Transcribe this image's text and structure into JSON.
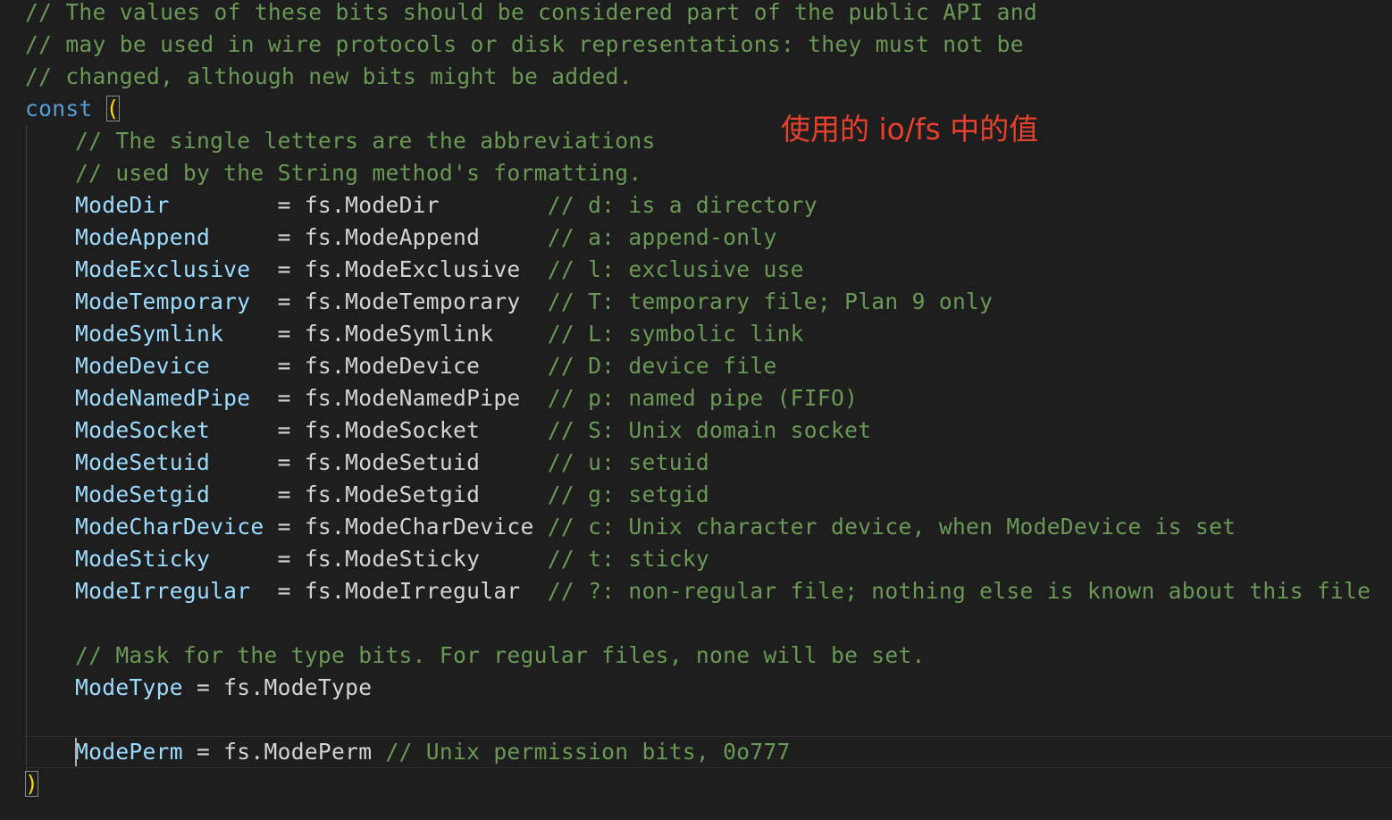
{
  "header_comments": [
    "// The values of these bits should be considered part of the public API and",
    "// may be used in wire protocols or disk representations: they must not be",
    "// changed, although new bits might be added."
  ],
  "const_keyword": "const",
  "open_paren": "(",
  "close_paren": ")",
  "block_comments": [
    "// The single letters are the abbreviations",
    "// used by the String method's formatting."
  ],
  "assignments": [
    {
      "name": "ModeDir        ",
      "value": "= fs.ModeDir        ",
      "comment": "// d: is a directory"
    },
    {
      "name": "ModeAppend     ",
      "value": "= fs.ModeAppend     ",
      "comment": "// a: append-only"
    },
    {
      "name": "ModeExclusive  ",
      "value": "= fs.ModeExclusive  ",
      "comment": "// l: exclusive use"
    },
    {
      "name": "ModeTemporary  ",
      "value": "= fs.ModeTemporary  ",
      "comment": "// T: temporary file; Plan 9 only"
    },
    {
      "name": "ModeSymlink    ",
      "value": "= fs.ModeSymlink    ",
      "comment": "// L: symbolic link"
    },
    {
      "name": "ModeDevice     ",
      "value": "= fs.ModeDevice     ",
      "comment": "// D: device file"
    },
    {
      "name": "ModeNamedPipe  ",
      "value": "= fs.ModeNamedPipe  ",
      "comment": "// p: named pipe (FIFO)"
    },
    {
      "name": "ModeSocket     ",
      "value": "= fs.ModeSocket     ",
      "comment": "// S: Unix domain socket"
    },
    {
      "name": "ModeSetuid     ",
      "value": "= fs.ModeSetuid     ",
      "comment": "// u: setuid"
    },
    {
      "name": "ModeSetgid     ",
      "value": "= fs.ModeSetgid     ",
      "comment": "// g: setgid"
    },
    {
      "name": "ModeCharDevice ",
      "value": "= fs.ModeCharDevice ",
      "comment": "// c: Unix character device, when ModeDevice is set"
    },
    {
      "name": "ModeSticky     ",
      "value": "= fs.ModeSticky     ",
      "comment": "// t: sticky"
    },
    {
      "name": "ModeIrregular  ",
      "value": "= fs.ModeIrregular  ",
      "comment": "// ?: non-regular file; nothing else is known about this file"
    }
  ],
  "mask_comment": "// Mask for the type bits. For regular files, none will be set.",
  "mode_type": {
    "name": "ModeType",
    "value": " = fs.ModeType"
  },
  "mode_perm": {
    "name": "ModePerm",
    "value": " = fs.ModePerm ",
    "comment": "// Unix permission bits, 0o777"
  },
  "annotation": "使用的 io/fs 中的值",
  "colors": {
    "background": "#1e1e1e",
    "comment": "#6a9955",
    "keyword": "#569cd6",
    "identifier": "#9cdcfe",
    "text": "#d4d4d4",
    "bracket": "#ffd700",
    "annotation": "#e8412c"
  }
}
